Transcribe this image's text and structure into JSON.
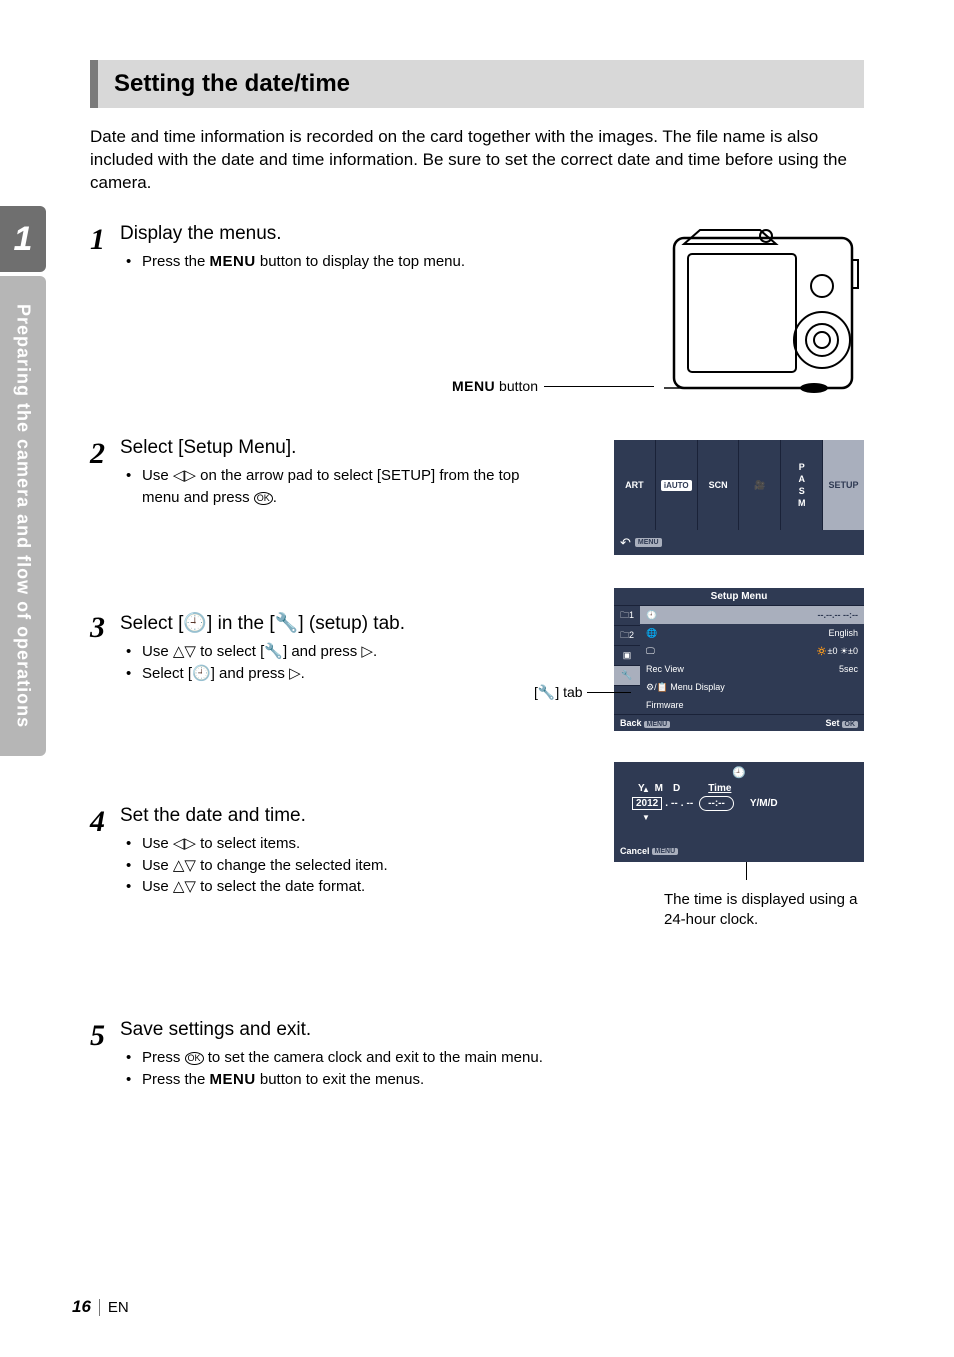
{
  "sidebar": {
    "chapter": "1",
    "label": "Preparing the camera and flow of operations"
  },
  "heading": "Setting the date/time",
  "intro": "Date and time information is recorded on the card together with the images. The file name is also included with the date and time information. Be sure to set the correct date and time before using the camera.",
  "steps": {
    "s1": {
      "num": "1",
      "title": "Display the menus.",
      "b1a": "Press the ",
      "b1b": " button to display the top menu."
    },
    "s2": {
      "num": "2",
      "title": "Select [Setup Menu].",
      "b1a": "Use ",
      "b1b": " on the arrow pad to select [SETUP] from the top menu and press ",
      "b1c": "."
    },
    "s3": {
      "num": "3",
      "title_a": "Select [",
      "title_b": "] in the [",
      "title_c": "] (setup) tab.",
      "b1a": "Use ",
      "b1b": " to select [",
      "b1c": "] and press ",
      "b1d": ".",
      "b2a": "Select [",
      "b2b": "] and press ",
      "b2c": "."
    },
    "s4": {
      "num": "4",
      "title": "Set the date and time.",
      "b1a": "Use ",
      "b1b": " to select items.",
      "b2a": "Use ",
      "b2b": " to change the selected item.",
      "b3a": "Use ",
      "b3b": " to select the date format."
    },
    "s5": {
      "num": "5",
      "title": "Save settings and exit.",
      "b1a": "Press ",
      "b1b": " to set the camera clock and exit to the main menu.",
      "b2a": "Press the ",
      "b2b": " button to exit the menus."
    }
  },
  "labels": {
    "menu_word": "MENU",
    "menu_button_label": " button",
    "ok": "OK",
    "setup_tab_label_a": "[",
    "setup_tab_label_b": "] tab"
  },
  "glyphs": {
    "left": "◁",
    "right": "▷",
    "up": "△",
    "down": "▽",
    "clock": "🕘",
    "wrench": "🔧"
  },
  "topmenu": {
    "c1": "ART",
    "c2": "iAUTO",
    "c3": "SCN",
    "c4": "🎥",
    "c5a": "P",
    "c5b": "A",
    "c5c": "S",
    "c5d": "M",
    "c6": "SETUP",
    "back": "↶",
    "menuchip": "MENU"
  },
  "setupmenu": {
    "title": "Setup Menu",
    "tab1": "🗀1",
    "tab2": "🗀2",
    "tab3": "▣",
    "tab4": "🔧",
    "r1l": "🕘",
    "r1r": "--.--.-- --:--",
    "r2l": "🌐",
    "r2r": "English",
    "r3l": "🖵",
    "r3r": "🔅±0 ☀±0",
    "r4l": "Rec View",
    "r4r": "5sec",
    "r5l": "⚙/📋 Menu Display",
    "r5r": "",
    "r6l": "Firmware",
    "r6r": "",
    "back": "Back",
    "backchip": "MENU",
    "set": "Set",
    "setchip": "OK"
  },
  "dt": {
    "title": "🕘",
    "Y": "Y",
    "M": "M",
    "D": "D",
    "Time": "Time",
    "year": "2012",
    "dash": "--",
    "sep": ".",
    "colon": ":",
    "fmt": "Y/M/D",
    "cancel": "Cancel",
    "cancelchip": "MENU",
    "caption": "The time is displayed using a 24-hour clock."
  },
  "footer": {
    "page": "16",
    "lang": "EN"
  }
}
